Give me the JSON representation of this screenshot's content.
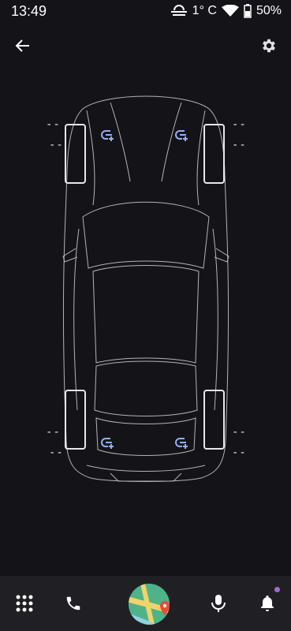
{
  "status": {
    "time": "13:49",
    "temperature": "1° C",
    "battery": "50%"
  },
  "tires": {
    "front_left": {
      "pressure": "--",
      "temp": "--"
    },
    "front_right": {
      "pressure": "--",
      "temp": "--"
    },
    "rear_left": {
      "pressure": "--",
      "temp": "--"
    },
    "rear_right": {
      "pressure": "--",
      "temp": "--"
    }
  },
  "colors": {
    "background": "#141418",
    "nav": "#202024",
    "sensor": "#8fb0ff",
    "accent": "#9b6bd6"
  },
  "icons": {
    "back": "arrow-left-icon",
    "settings": "gear-icon",
    "apps": "grid-icon",
    "phone": "phone-icon",
    "maps": "map-icon",
    "mic": "mic-icon",
    "notifications": "bell-icon"
  }
}
